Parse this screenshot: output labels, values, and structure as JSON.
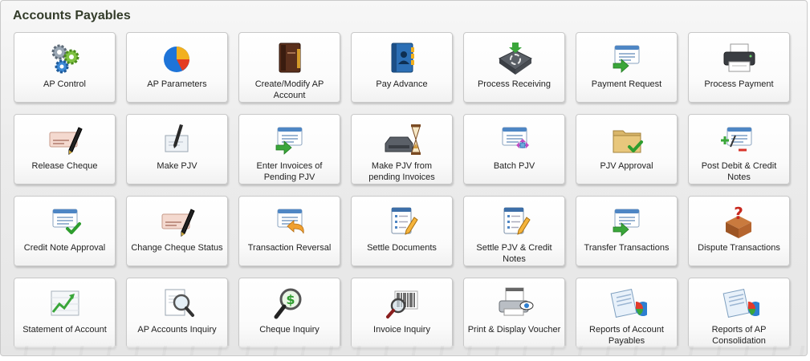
{
  "page": {
    "title": "Accounts Payables"
  },
  "tiles": [
    {
      "label": "AP Control",
      "icon": "gears-icon"
    },
    {
      "label": "AP Parameters",
      "icon": "pie-chart-icon"
    },
    {
      "label": "Create/Modify AP Account",
      "icon": "ledger-book-icon"
    },
    {
      "label": "Pay Advance",
      "icon": "address-book-icon"
    },
    {
      "label": "Process Receiving",
      "icon": "recycle-box-icon"
    },
    {
      "label": "Payment Request",
      "icon": "window-arrow-icon"
    },
    {
      "label": "Process Payment",
      "icon": "printer-icon"
    },
    {
      "label": "Release Cheque",
      "icon": "cheque-pen-icon"
    },
    {
      "label": "Make PJV",
      "icon": "pen-paper-icon"
    },
    {
      "label": "Enter Invoices of Pending PJV",
      "icon": "window-arrow-icon"
    },
    {
      "label": "Make PJV from pending Invoices",
      "icon": "inbox-hourglass-icon"
    },
    {
      "label": "Batch PJV",
      "icon": "window-move-icon"
    },
    {
      "label": "PJV Approval",
      "icon": "folder-check-icon"
    },
    {
      "label": "Post Debit & Credit Notes",
      "icon": "plus-minus-icon"
    },
    {
      "label": "Credit Note Approval",
      "icon": "window-check-icon"
    },
    {
      "label": "Change Cheque Status",
      "icon": "cheque-pen-icon"
    },
    {
      "label": "Transaction Reversal",
      "icon": "window-undo-icon"
    },
    {
      "label": "Settle Documents",
      "icon": "checklist-pencil-icon"
    },
    {
      "label": "Settle PJV & Credit Notes",
      "icon": "checklist-pencil-icon"
    },
    {
      "label": "Transfer Transactions",
      "icon": "window-arrow-icon"
    },
    {
      "label": "Dispute Transactions",
      "icon": "question-box-icon"
    },
    {
      "label": "Statement of Account",
      "icon": "line-chart-icon"
    },
    {
      "label": "AP Accounts Inquiry",
      "icon": "document-magnifier-icon"
    },
    {
      "label": "Cheque Inquiry",
      "icon": "dollar-magnifier-icon"
    },
    {
      "label": "Invoice Inquiry",
      "icon": "barcode-magnifier-icon"
    },
    {
      "label": "Print & Display Voucher",
      "icon": "invoice-printer-eye-icon"
    },
    {
      "label": "Reports of Account Payables",
      "icon": "report-chart-icon"
    },
    {
      "label": "Reports of AP Consolidation",
      "icon": "report-chart-icon"
    }
  ],
  "colors": {
    "title": "#333c2a",
    "green": "#3aa63a",
    "blue": "#2d6fb3"
  }
}
